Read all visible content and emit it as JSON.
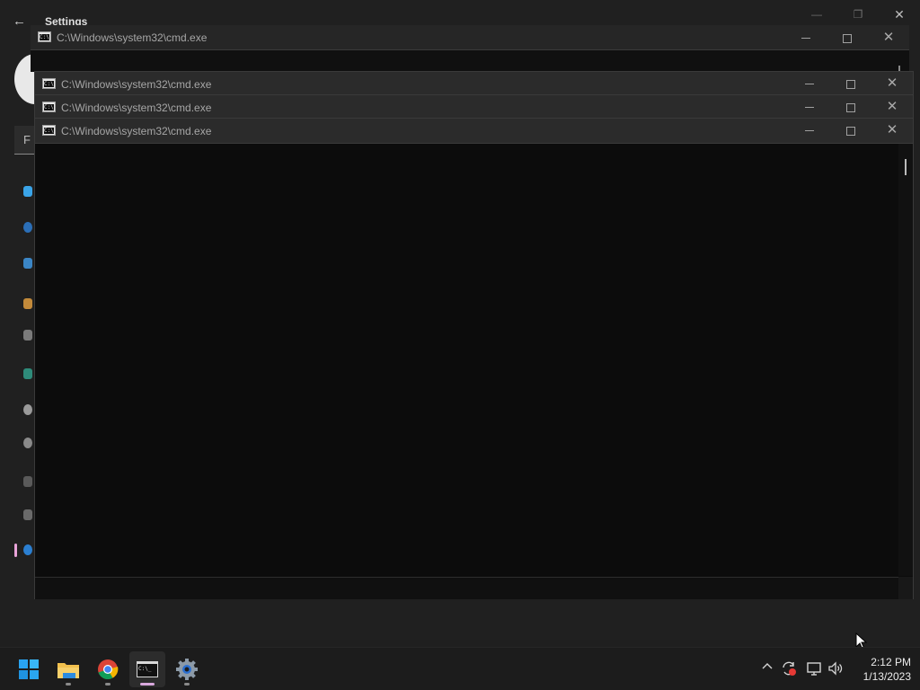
{
  "settings_window": {
    "title": "Settings",
    "back_label": "←",
    "search_initial": "F"
  },
  "cmd_windows": [
    {
      "title": "C:\\Windows\\system32\\cmd.exe"
    },
    {
      "title": "C:\\Windows\\system32\\cmd.exe"
    },
    {
      "title": "C:\\Windows\\system32\\cmd.exe"
    },
    {
      "title": "C:\\Windows\\system32\\cmd.exe"
    }
  ],
  "taskbar": {
    "apps": [
      {
        "name": "Start",
        "icon": "windows-start-icon"
      },
      {
        "name": "File Explorer",
        "icon": "folder-icon",
        "running": true
      },
      {
        "name": "Google Chrome",
        "icon": "chrome-icon",
        "running": true
      },
      {
        "name": "Command Prompt",
        "icon": "terminal-icon",
        "running": true,
        "active": true
      },
      {
        "name": "Settings",
        "icon": "gear-icon",
        "running": true
      }
    ],
    "tray": {
      "icons": [
        "chevron-up-icon",
        "sync-icon",
        "network-icon",
        "volume-icon"
      ]
    },
    "clock": {
      "time": "2:12 PM",
      "date": "1/13/2023"
    }
  },
  "colors": {
    "accent_pink": "#d9a8dd",
    "windows_blue": "#29a3f0",
    "folder_yellow": "#f2c04d"
  }
}
